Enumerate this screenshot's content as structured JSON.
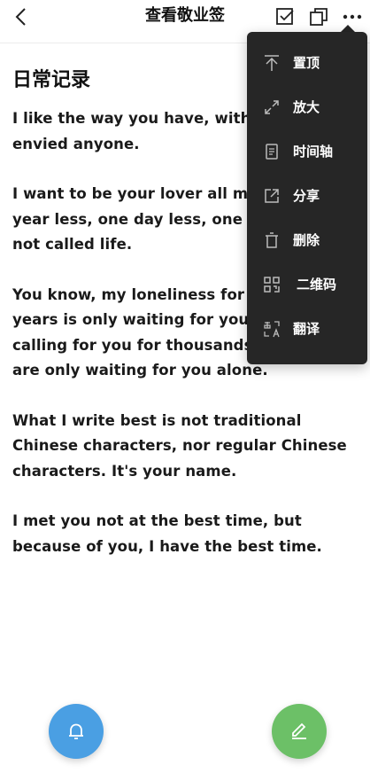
{
  "header": {
    "title": "查看敬业签",
    "icons": [
      "back-icon",
      "checkbox-icon",
      "copy-icon",
      "more-icon"
    ]
  },
  "note": {
    "heading": "日常记录",
    "paragraphs": [
      "I like the way you have, with you I never envied anyone.",
      "I want to be your lover all my life, one year less, one day less, one hour less is not called life.",
      "You know, my loneliness for a thousand years is only waiting for you alone, calling for you for thousands of nights are only waiting for you alone.",
      "What I write best is not traditional Chinese characters, nor regular Chinese characters. It's your name.",
      "I met you not at the best time, but because of you, I have the best time."
    ]
  },
  "menu": {
    "items": [
      {
        "label": "置顶",
        "icon": "pin-top-icon"
      },
      {
        "label": "放大",
        "icon": "expand-icon"
      },
      {
        "label": "时间轴",
        "icon": "timeline-icon"
      },
      {
        "label": "分享",
        "icon": "share-icon"
      },
      {
        "label": "删除",
        "icon": "trash-icon"
      },
      {
        "label": "二维码",
        "icon": "qr-code-icon"
      },
      {
        "label": "翻译",
        "icon": "translate-icon"
      }
    ]
  },
  "fabs": {
    "reminder": {
      "icon": "bell-icon",
      "color": "#4a9fe3"
    },
    "edit": {
      "icon": "pencil-icon",
      "color": "#6cc067"
    }
  },
  "colors": {
    "menu_bg": "#262626",
    "menu_text": "#ffffff",
    "text": "#1a1a1a"
  }
}
